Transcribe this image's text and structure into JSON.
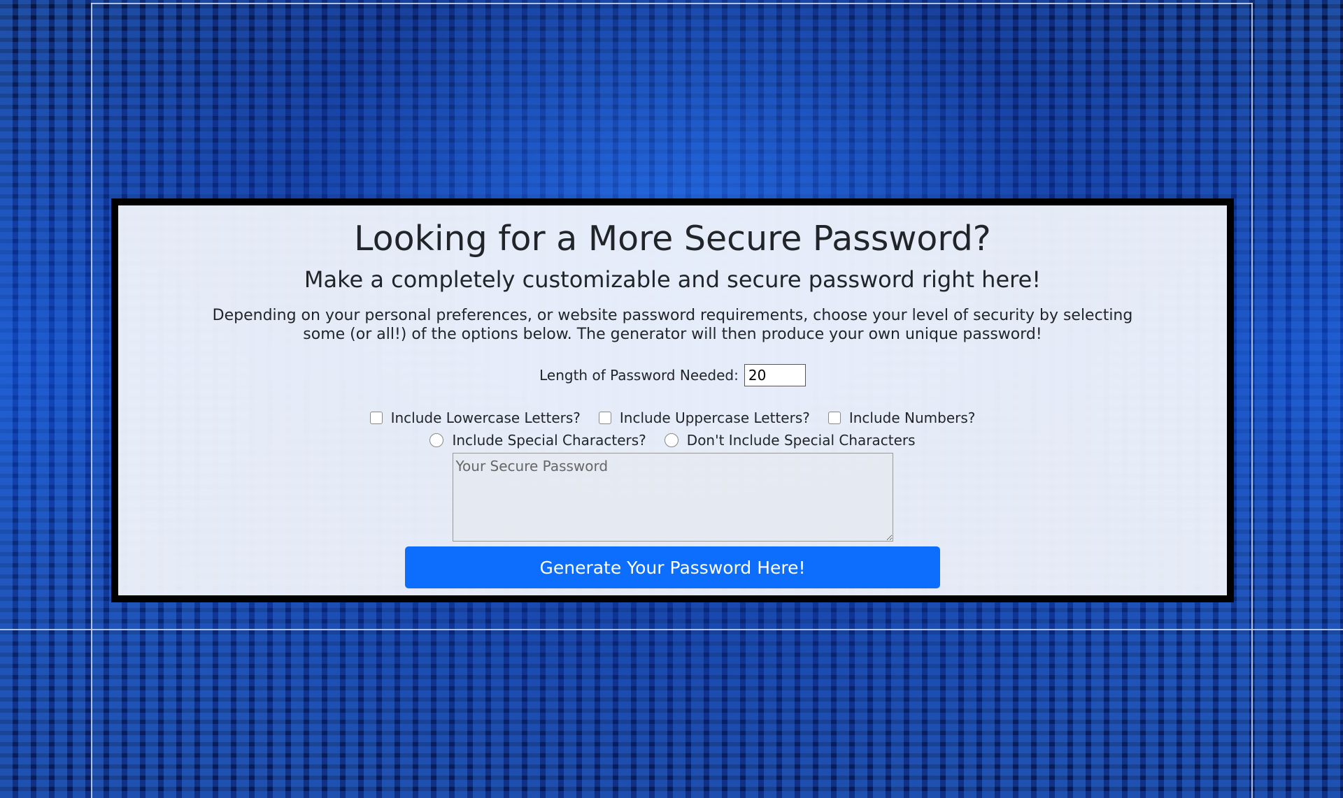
{
  "header": {
    "title": "Looking for a More Secure Password?",
    "subtitle": "Make a completely customizable and secure password right here!"
  },
  "description": "Depending on your personal preferences, or website password requirements, choose your level of security by selecting some (or all!) of the options below. The generator will then produce your own unique password!",
  "length": {
    "label": "Length of Password Needed:",
    "value": "20"
  },
  "options": {
    "lowercase": "Include Lowercase Letters?",
    "uppercase": "Include Uppercase Letters?",
    "numbers": "Include Numbers?",
    "special": "Include Special Characters?",
    "no_special": "Don't Include Special Characters"
  },
  "output": {
    "placeholder": "Your Secure Password"
  },
  "button": {
    "label": "Generate Your Password Here!"
  },
  "colors": {
    "button": "#0d6efd",
    "panel_border": "#000000",
    "background": "#0b3fb0"
  }
}
